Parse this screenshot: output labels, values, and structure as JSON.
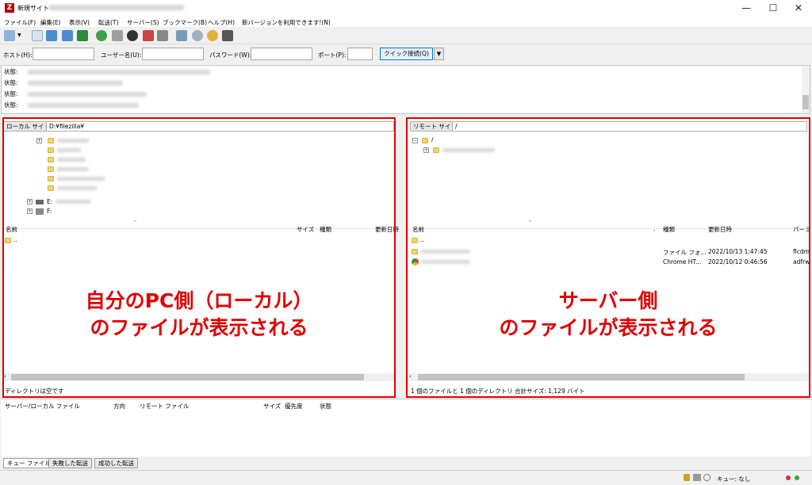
{
  "window": {
    "app_icon": "filezilla-icon",
    "title": "新規サイト -",
    "controls": {
      "minimize": "—",
      "maximize": "☐",
      "close": "✕"
    }
  },
  "menu": [
    "ファイル(F)",
    "編集(E)",
    "表示(V)",
    "転送(T)",
    "サーバー(S)",
    "ブックマーク(B)",
    "ヘルプ(H)",
    "新バージョンを利用できます!(N)"
  ],
  "quickconnect": {
    "host_label": "ホスト(H):",
    "user_label": "ユーザー名(U):",
    "pass_label": "パスワード(W):",
    "port_label": "ポート(P):",
    "connect_button": "クイック接続(Q)",
    "dropdown_arrow": "▼"
  },
  "log": {
    "lines": [
      "状態:",
      "状態:",
      "状態:",
      "状態:"
    ]
  },
  "local": {
    "site_label": "ローカル サイト:",
    "path": "D:¥filezilla¥",
    "drives": [
      "E:",
      "F:"
    ],
    "columns": {
      "name": "名前",
      "size": "サイズ",
      "type": "種類",
      "modified": "更新日時"
    },
    "parent_dir": "..",
    "status": "ディレクトリは空です"
  },
  "remote": {
    "site_label": "リモート サイト:",
    "path": "/",
    "root": "/",
    "columns": {
      "name": "名前",
      "dot": ".",
      "type": "種類",
      "modified": "更新日時",
      "perm": "パーミ"
    },
    "parent_dir": "..",
    "files": [
      {
        "type": "ファイル フォ...",
        "modified": "2022/10/13 1:47:45",
        "perm": "flcdm"
      },
      {
        "type": "Chrome HT...",
        "modified": "2022/10/12 0:46:56",
        "perm": "adfrw"
      }
    ],
    "status": "1 個のファイルと 1 個のディレクトリ 合計サイズ: 1,129 バイト"
  },
  "annotations": {
    "local_line1": "自分のPC側（ローカル）",
    "local_line2": "のファイルが表示される",
    "remote_line1": "サーバー側",
    "remote_line2": "のファイルが表示される"
  },
  "queue": {
    "columns": {
      "file": "サーバー/ローカル ファイル",
      "direction": "方向",
      "remote": "リモート ファイル",
      "size": "サイズ",
      "priority": "優先度",
      "state": "状態"
    },
    "tabs": [
      "キュー ファイル",
      "失敗した転送",
      "成功した転送"
    ],
    "status": "キュー: なし"
  },
  "colors": {
    "annotation": "#e00000",
    "accent": "#0078d7"
  }
}
